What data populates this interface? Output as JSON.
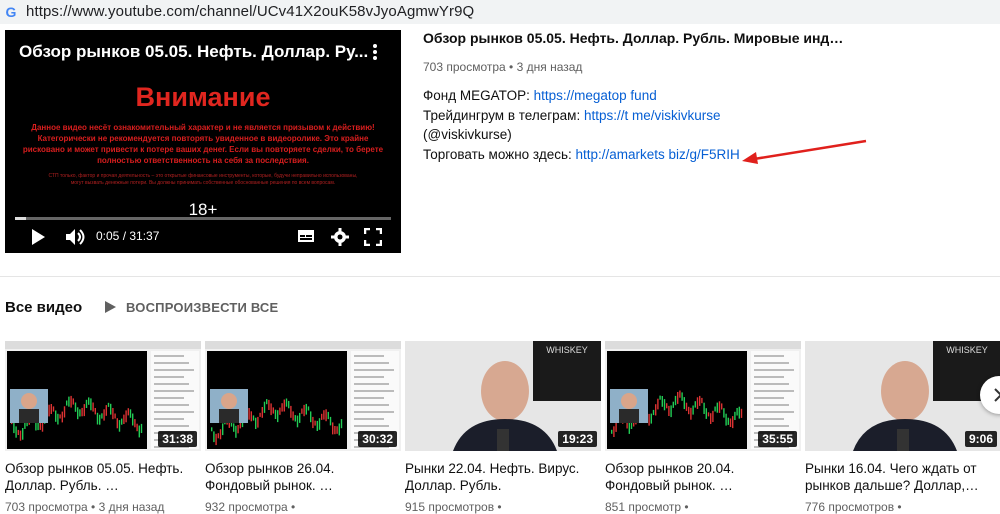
{
  "browser": {
    "url": "https://www.youtube.com/channel/UCv41X2ouK58vJyoAgmwYr9Q"
  },
  "player": {
    "title": "Обзор рынков 05.05. Нефть. Доллар. Ру...",
    "warning_heading": "Внимание",
    "warning_text": "Данное видео несёт ознакомительный характер и не является призывом к действию! Категорически не рекомендуется повторять увиденное в видеоролике. Это крайне рисковано и может привести к потере ваших денег. Если вы повторяете сделки, то берете полностью ответственность на себя за последствия.",
    "small_text": "СТП только, фактор и прочая деятельность  –  это открытые финансовые инструменты, которые, будучи неправильно использованы, могут вызвать денежные потери. Вы должны принимать собственные обоснованные решения по всем вопросам.",
    "age_label": "18+",
    "time": "0:05 / 31:37",
    "progress": 0.03
  },
  "info": {
    "title": "Обзор рынков 05.05. Нефть. Доллар. Рубль. Мировые инд…",
    "views": "703 просмотра",
    "age": "3 дня назад",
    "line1_label": "Фонд MEGATOP: ",
    "line1_link": "https://megatop fund",
    "line2_label": "Трейдингрум в телеграм: ",
    "line2_link": "https://t me/viskivkurse",
    "line3": "(@viskivkurse)",
    "line4_label": "Торговать можно здесь: ",
    "line4_link": "http://amarkets biz/g/F5RIH"
  },
  "section": {
    "title": "Все видео",
    "play_all": "ВОСПРОИЗВЕСТИ ВСЕ"
  },
  "videos": [
    {
      "title": "Обзор рынков 05.05. Нефть. Доллар. Рубль. …",
      "duration": "31:38",
      "views": "703 просмотра",
      "age": "3 дня назад",
      "kind": "chart"
    },
    {
      "title": "Обзор рынков 26.04. Фондовый рынок. …",
      "duration": "30:32",
      "views": "932 просмотра",
      "age": "",
      "kind": "chart"
    },
    {
      "title": "Рынки 22.04. Нефть. Вирус. Доллар. Рубль.",
      "duration": "19:23",
      "views": "915 просмотров",
      "age": "",
      "kind": "person"
    },
    {
      "title": "Обзор рынков 20.04. Фондовый рынок. …",
      "duration": "35:55",
      "views": "851 просмотр",
      "age": "",
      "kind": "chart"
    },
    {
      "title": "Рынки 16.04. Чего ждать от рынков дальше? Доллар,…",
      "duration": "9:06",
      "views": "776 просмотров",
      "age": "",
      "kind": "person"
    }
  ],
  "thumb_badge": "WHISKEY",
  "colors": {
    "link": "#065fd4",
    "warning_red": "#e0261f",
    "annotation_arrow": "#e0201c"
  }
}
